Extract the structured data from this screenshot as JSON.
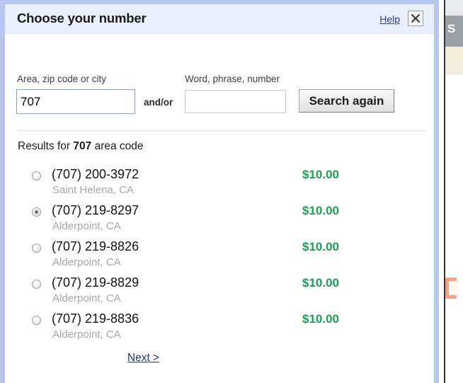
{
  "dialog": {
    "title": "Choose your number",
    "help_label": "Help",
    "close_icon": "close-x-icon"
  },
  "search_form": {
    "area_label": "Area, zip code or city",
    "area_value": "707",
    "area_placeholder": "",
    "and_or_label": "and/or",
    "word_label": "Word, phrase, number",
    "word_value": "",
    "word_placeholder": "",
    "search_button_label": "Search again"
  },
  "results": {
    "heading_prefix": "Results for ",
    "heading_query": "707",
    "heading_suffix": " area code",
    "items": [
      {
        "number": "(707) 200-3972",
        "city": "Saint Helena, CA",
        "price": "$10.00",
        "selected": false
      },
      {
        "number": "(707) 219-8297",
        "city": "Alderpoint, CA",
        "price": "$10.00",
        "selected": true
      },
      {
        "number": "(707) 219-8826",
        "city": "Alderpoint, CA",
        "price": "$10.00",
        "selected": false
      },
      {
        "number": "(707) 219-8829",
        "city": "Alderpoint, CA",
        "price": "$10.00",
        "selected": false
      },
      {
        "number": "(707) 219-8836",
        "city": "Alderpoint, CA",
        "price": "$10.00",
        "selected": false
      }
    ],
    "next_label": "Next >"
  },
  "background_page": {
    "visible_glyph": "S"
  },
  "colors": {
    "dialog_border": "#b7c6ee",
    "header_bg": "#eaeffc",
    "link": "#23367f",
    "price_green": "#1e9e51",
    "city_gray": "#a8a8a8",
    "input_focus_border": "#7da2d8"
  }
}
